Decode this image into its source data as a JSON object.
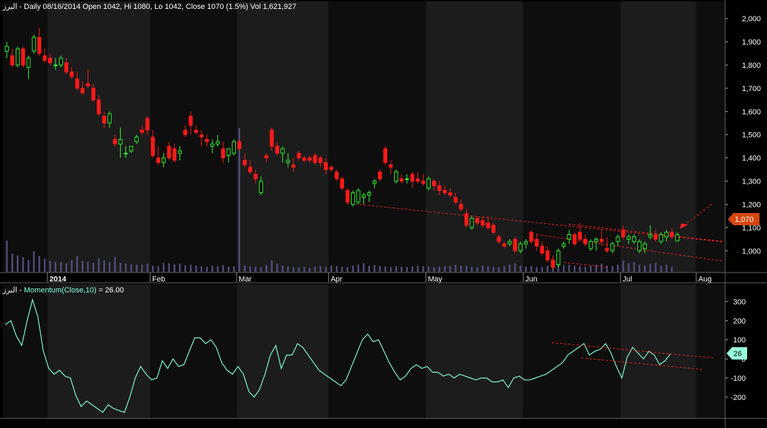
{
  "header_price": "البرز - Daily 08/16/2014 Open 1042, Hi 1080, Lo 1042, Close 1070 (1.5%) Vol 1,621,927",
  "header_indicator_prefix": "البرز - ",
  "header_indicator_name": "Momentum(Close,10)",
  "header_indicator_value": " = 26.00",
  "last_price_badge": "1,070",
  "last_indicator_badge": "26",
  "colors": {
    "background": "#000000",
    "panel_alt": "#1a1a1a",
    "up_candle": "#33ff33",
    "down_candle": "#ff1a1a",
    "volume": "#505080",
    "momentum_line": "#80ffdd",
    "trendline": "#ff2020",
    "price_badge": "#d4470f",
    "indicator_badge": "#99ffdd",
    "axis_text": "#ffffff"
  },
  "chart_data": [
    {
      "type": "candlestick",
      "title": "البرز - Daily 08/16/2014 Open 1042, Hi 1080, Lo 1042, Close 1070 (1.5%) Vol 1,621,927",
      "y_ticks": [
        "2,000",
        "1,900",
        "1,800",
        "1,700",
        "1,600",
        "1,500",
        "1,400",
        "1,300",
        "1,200",
        "1,100",
        "1,000"
      ],
      "y_tick_values": [
        2000,
        1900,
        1800,
        1700,
        1600,
        1500,
        1400,
        1300,
        1200,
        1100,
        1000
      ],
      "ylim": [
        930,
        2030
      ],
      "x_ticks": [
        "2014",
        "Feb",
        "Mar",
        "Apr",
        "May",
        "Jun",
        "Jul",
        "Aug"
      ],
      "x_tick_index": [
        8,
        27,
        43,
        60,
        78,
        96,
        114,
        128
      ],
      "candles": [
        [
          1860,
          1900,
          1830,
          1880
        ],
        [
          1840,
          1870,
          1790,
          1800
        ],
        [
          1800,
          1880,
          1790,
          1870
        ],
        [
          1870,
          1880,
          1790,
          1800
        ],
        [
          1790,
          1840,
          1740,
          1830
        ],
        [
          1860,
          1930,
          1850,
          1920
        ],
        [
          1920,
          1960,
          1840,
          1850
        ],
        [
          1840,
          1870,
          1810,
          1820
        ],
        [
          1830,
          1850,
          1800,
          1810
        ],
        [
          1800,
          1830,
          1780,
          1800
        ],
        [
          1800,
          1840,
          1790,
          1830
        ],
        [
          1810,
          1830,
          1760,
          1770
        ],
        [
          1770,
          1790,
          1740,
          1750
        ],
        [
          1740,
          1770,
          1690,
          1700
        ],
        [
          1700,
          1730,
          1670,
          1680
        ],
        [
          1720,
          1780,
          1700,
          1710
        ],
        [
          1700,
          1720,
          1640,
          1650
        ],
        [
          1650,
          1670,
          1580,
          1590
        ],
        [
          1580,
          1600,
          1530,
          1550
        ],
        [
          1550,
          1600,
          1530,
          1590
        ],
        [
          1480,
          1500,
          1450,
          1460
        ],
        [
          1460,
          1530,
          1400,
          1480
        ],
        [
          1420,
          1450,
          1400,
          1420
        ],
        [
          1430,
          1450,
          1420,
          1450
        ],
        [
          1470,
          1500,
          1460,
          1490
        ],
        [
          1520,
          1540,
          1500,
          1510
        ],
        [
          1570,
          1580,
          1500,
          1520
        ],
        [
          1490,
          1520,
          1400,
          1410
        ],
        [
          1400,
          1450,
          1370,
          1380
        ],
        [
          1380,
          1420,
          1360,
          1400
        ],
        [
          1450,
          1470,
          1390,
          1400
        ],
        [
          1440,
          1460,
          1380,
          1390
        ],
        [
          1420,
          1450,
          1390,
          1430
        ],
        [
          1520,
          1540,
          1490,
          1500
        ],
        [
          1580,
          1600,
          1500,
          1540
        ],
        [
          1520,
          1540,
          1500,
          1510
        ],
        [
          1500,
          1520,
          1450,
          1490
        ],
        [
          1480,
          1500,
          1450,
          1470
        ],
        [
          1450,
          1480,
          1420,
          1460
        ],
        [
          1460,
          1500,
          1450,
          1470
        ],
        [
          1440,
          1470,
          1380,
          1400
        ],
        [
          1410,
          1430,
          1380,
          1440
        ],
        [
          1420,
          1480,
          1410,
          1470
        ],
        [
          1470,
          1480,
          1430,
          1440
        ],
        [
          1390,
          1420,
          1360,
          1370
        ],
        [
          1360,
          1390,
          1330,
          1340
        ],
        [
          1330,
          1350,
          1290,
          1310
        ],
        [
          1250,
          1320,
          1240,
          1300
        ],
        [
          1410,
          1420,
          1380,
          1400
        ],
        [
          1520,
          1530,
          1430,
          1450
        ],
        [
          1450,
          1470,
          1410,
          1420
        ],
        [
          1420,
          1450,
          1380,
          1440
        ],
        [
          1380,
          1420,
          1360,
          1390
        ],
        [
          1370,
          1400,
          1340,
          1360
        ],
        [
          1420,
          1430,
          1390,
          1400
        ],
        [
          1400,
          1410,
          1380,
          1390
        ],
        [
          1400,
          1410,
          1380,
          1390
        ],
        [
          1410,
          1420,
          1370,
          1380
        ],
        [
          1400,
          1410,
          1360,
          1380
        ],
        [
          1380,
          1400,
          1330,
          1350
        ],
        [
          1360,
          1370,
          1340,
          1350
        ],
        [
          1340,
          1350,
          1300,
          1310
        ],
        [
          1310,
          1320,
          1260,
          1270
        ],
        [
          1260,
          1270,
          1200,
          1210
        ],
        [
          1200,
          1260,
          1190,
          1250
        ],
        [
          1210,
          1270,
          1200,
          1260
        ],
        [
          1230,
          1250,
          1200,
          1240
        ],
        [
          1240,
          1260,
          1210,
          1250
        ],
        [
          1290,
          1310,
          1270,
          1300
        ],
        [
          1340,
          1350,
          1300,
          1310
        ],
        [
          1440,
          1450,
          1370,
          1380
        ],
        [
          1370,
          1390,
          1330,
          1360
        ],
        [
          1300,
          1350,
          1290,
          1340
        ],
        [
          1310,
          1330,
          1290,
          1300
        ],
        [
          1310,
          1330,
          1290,
          1310
        ],
        [
          1330,
          1340,
          1270,
          1300
        ],
        [
          1310,
          1340,
          1290,
          1300
        ],
        [
          1300,
          1330,
          1280,
          1290
        ],
        [
          1270,
          1320,
          1260,
          1310
        ],
        [
          1300,
          1310,
          1260,
          1280
        ],
        [
          1280,
          1300,
          1240,
          1260
        ],
        [
          1260,
          1280,
          1240,
          1250
        ],
        [
          1250,
          1270,
          1230,
          1240
        ],
        [
          1230,
          1250,
          1200,
          1210
        ],
        [
          1200,
          1220,
          1170,
          1180
        ],
        [
          1160,
          1180,
          1100,
          1110
        ],
        [
          1100,
          1150,
          1090,
          1140
        ],
        [
          1140,
          1150,
          1110,
          1120
        ],
        [
          1130,
          1150,
          1100,
          1110
        ],
        [
          1120,
          1150,
          1090,
          1100
        ],
        [
          1110,
          1120,
          1070,
          1080
        ],
        [
          1060,
          1070,
          1030,
          1040
        ],
        [
          1030,
          1040,
          1010,
          1020
        ],
        [
          1030,
          1050,
          1020,
          1040
        ],
        [
          1050,
          1060,
          990,
          1000
        ],
        [
          1000,
          1040,
          990,
          1030
        ],
        [
          1030,
          1050,
          1010,
          1040
        ],
        [
          1080,
          1090,
          1030,
          1040
        ],
        [
          1050,
          1070,
          1000,
          1020
        ],
        [
          1020,
          1040,
          980,
          990
        ],
        [
          1000,
          1020,
          950,
          960
        ],
        [
          960,
          980,
          920,
          930
        ],
        [
          940,
          1010,
          930,
          1000
        ],
        [
          1020,
          1040,
          1010,
          1030
        ],
        [
          1050,
          1090,
          1030,
          1070
        ],
        [
          1070,
          1080,
          1020,
          1030
        ],
        [
          1080,
          1120,
          1040,
          1050
        ],
        [
          1050,
          1070,
          1020,
          1030
        ],
        [
          1010,
          1050,
          1000,
          1040
        ],
        [
          1040,
          1060,
          1000,
          1050
        ],
        [
          1050,
          1090,
          1020,
          1040
        ],
        [
          1010,
          1060,
          990,
          1000
        ],
        [
          1000,
          1040,
          990,
          1030
        ],
        [
          1040,
          1070,
          1020,
          1060
        ],
        [
          1090,
          1110,
          1050,
          1060
        ],
        [
          1050,
          1070,
          1030,
          1060
        ],
        [
          1040,
          1070,
          1030,
          1060
        ],
        [
          1000,
          1050,
          990,
          1040
        ],
        [
          1010,
          1040,
          990,
          1030
        ],
        [
          1060,
          1110,
          1050,
          1070
        ],
        [
          1070,
          1090,
          1040,
          1050
        ],
        [
          1040,
          1080,
          1030,
          1070
        ],
        [
          1060,
          1090,
          1040,
          1080
        ],
        [
          1080,
          1100,
          1050,
          1060
        ],
        [
          1042,
          1080,
          1042,
          1070
        ]
      ],
      "volume": [
        0.62,
        0.35,
        0.31,
        0.28,
        0.22,
        0.4,
        0.3,
        0.25,
        0.2,
        0.18,
        0.17,
        0.15,
        0.22,
        0.3,
        0.2,
        0.18,
        0.16,
        0.25,
        0.21,
        0.18,
        0.28,
        0.16,
        0.14,
        0.13,
        0.12,
        0.12,
        0.14,
        0.1,
        0.09,
        0.16,
        0.15,
        0.13,
        0.14,
        0.11,
        0.12,
        0.1,
        0.09,
        0.08,
        0.1,
        0.09,
        0.11,
        0.08,
        0.09,
        1.0,
        0.1,
        0.09,
        0.08,
        0.07,
        0.12,
        0.21,
        0.14,
        0.1,
        0.08,
        0.07,
        0.06,
        0.07,
        0.06,
        0.08,
        0.09,
        0.08,
        0.1,
        0.09,
        0.08,
        0.07,
        0.1,
        0.12,
        0.15,
        0.1,
        0.11,
        0.09,
        0.08,
        0.07,
        0.09,
        0.08,
        0.07,
        0.08,
        0.1,
        0.09,
        0.08,
        0.07,
        0.08,
        0.09,
        0.1,
        0.12,
        0.1,
        0.09,
        0.08,
        0.07,
        0.1,
        0.09,
        0.08,
        0.07,
        0.09,
        0.12,
        0.15,
        0.1,
        0.08,
        0.09,
        0.07,
        0.08,
        0.1,
        0.09,
        0.14,
        0.11,
        0.12,
        0.1,
        0.09,
        0.08,
        0.1,
        0.12,
        0.14,
        0.1,
        0.09,
        0.12,
        0.2,
        0.15,
        0.18,
        0.12,
        0.1,
        0.14,
        0.16,
        0.1,
        0.12,
        0.08
      ]
    },
    {
      "type": "line",
      "title": "Momentum(Close,10) = 26.00",
      "y_ticks": [
        "300",
        "200",
        "100",
        "0",
        "-100",
        "-200"
      ],
      "y_tick_values": [
        300,
        200,
        100,
        0,
        -100,
        -200
      ],
      "ylim": [
        -290,
        330
      ],
      "values": [
        180,
        200,
        120,
        70,
        200,
        310,
        220,
        40,
        -50,
        -80,
        -60,
        -90,
        -100,
        -190,
        -250,
        -220,
        -240,
        -260,
        -280,
        -240,
        -260,
        -270,
        -280,
        -200,
        -100,
        -40,
        -80,
        -110,
        -100,
        -10,
        -50,
        0,
        -40,
        -30,
        40,
        110,
        110,
        80,
        100,
        60,
        -20,
        -60,
        -80,
        -40,
        -80,
        -170,
        -200,
        -160,
        -80,
        20,
        70,
        -50,
        20,
        20,
        80,
        60,
        20,
        -20,
        -60,
        -80,
        -100,
        -120,
        -140,
        -110,
        -40,
        30,
        100,
        130,
        90,
        100,
        40,
        -20,
        -70,
        -110,
        -90,
        -50,
        -30,
        -50,
        -40,
        -70,
        -70,
        -90,
        -80,
        -100,
        -80,
        -90,
        -100,
        -110,
        -100,
        -100,
        -120,
        -120,
        -110,
        -150,
        -100,
        -90,
        -110,
        -110,
        -100,
        -90,
        -80,
        -60,
        -40,
        -20,
        20,
        40,
        60,
        80,
        20,
        40,
        50,
        80,
        30,
        -40,
        -100,
        10,
        60,
        30,
        0,
        40,
        20,
        -30,
        -10,
        26
      ],
      "annotation": "26.00"
    }
  ]
}
